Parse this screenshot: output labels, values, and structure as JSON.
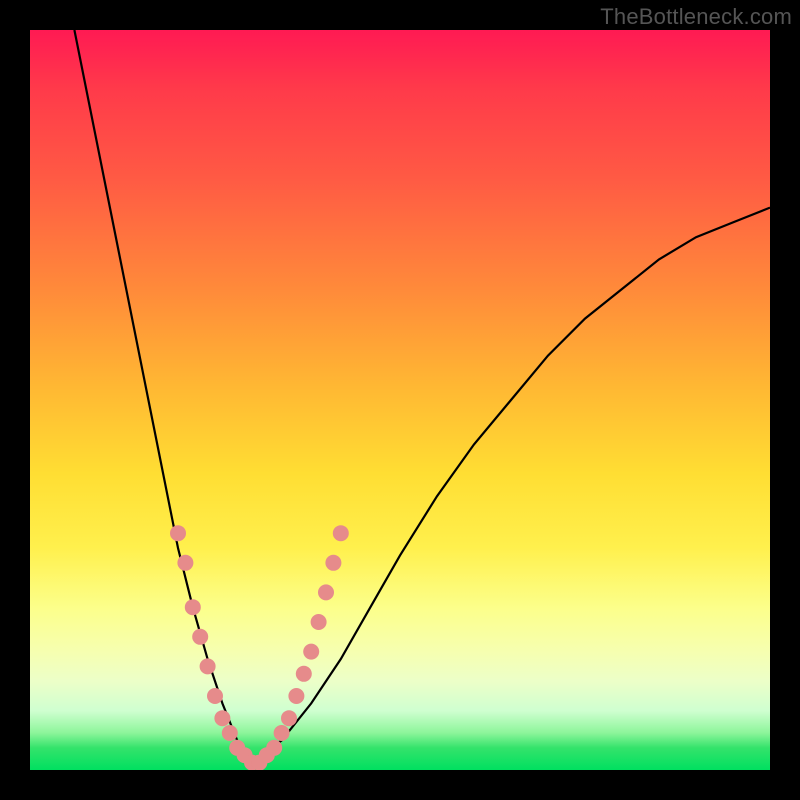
{
  "watermark": "TheBottleneck.com",
  "colors": {
    "gradient_top": "#ff1a53",
    "gradient_mid": "#ffde33",
    "gradient_bottom": "#00e060",
    "curve": "#000000",
    "dots": "#e68b8b",
    "frame": "#000000"
  },
  "chart_data": {
    "type": "line",
    "title": "",
    "xlabel": "",
    "ylabel": "",
    "xlim": [
      0,
      100
    ],
    "ylim": [
      0,
      100
    ],
    "description": "V-shaped bottleneck curve with steep left branch and shallower right branch; minimum near x≈30, y≈0. Salmon dots mark sampled points along both branches near the bottom.",
    "series": [
      {
        "name": "curve-left",
        "x": [
          6,
          8,
          10,
          12,
          14,
          16,
          18,
          20,
          22,
          24,
          26,
          28,
          30
        ],
        "y": [
          100,
          90,
          80,
          70,
          60,
          50,
          40,
          30,
          22,
          15,
          9,
          4,
          1
        ]
      },
      {
        "name": "curve-right",
        "x": [
          30,
          34,
          38,
          42,
          46,
          50,
          55,
          60,
          65,
          70,
          75,
          80,
          85,
          90,
          95,
          100
        ],
        "y": [
          1,
          4,
          9,
          15,
          22,
          29,
          37,
          44,
          50,
          56,
          61,
          65,
          69,
          72,
          74,
          76
        ]
      }
    ],
    "dots": {
      "left": [
        {
          "x": 20,
          "y": 32
        },
        {
          "x": 21,
          "y": 28
        },
        {
          "x": 22,
          "y": 22
        },
        {
          "x": 23,
          "y": 18
        },
        {
          "x": 24,
          "y": 14
        },
        {
          "x": 25,
          "y": 10
        },
        {
          "x": 26,
          "y": 7
        },
        {
          "x": 27,
          "y": 5
        },
        {
          "x": 28,
          "y": 3
        },
        {
          "x": 29,
          "y": 2
        },
        {
          "x": 30,
          "y": 1
        }
      ],
      "right": [
        {
          "x": 31,
          "y": 1
        },
        {
          "x": 32,
          "y": 2
        },
        {
          "x": 33,
          "y": 3
        },
        {
          "x": 34,
          "y": 5
        },
        {
          "x": 35,
          "y": 7
        },
        {
          "x": 36,
          "y": 10
        },
        {
          "x": 37,
          "y": 13
        },
        {
          "x": 38,
          "y": 16
        },
        {
          "x": 39,
          "y": 20
        },
        {
          "x": 40,
          "y": 24
        },
        {
          "x": 41,
          "y": 28
        },
        {
          "x": 42,
          "y": 32
        }
      ]
    }
  }
}
